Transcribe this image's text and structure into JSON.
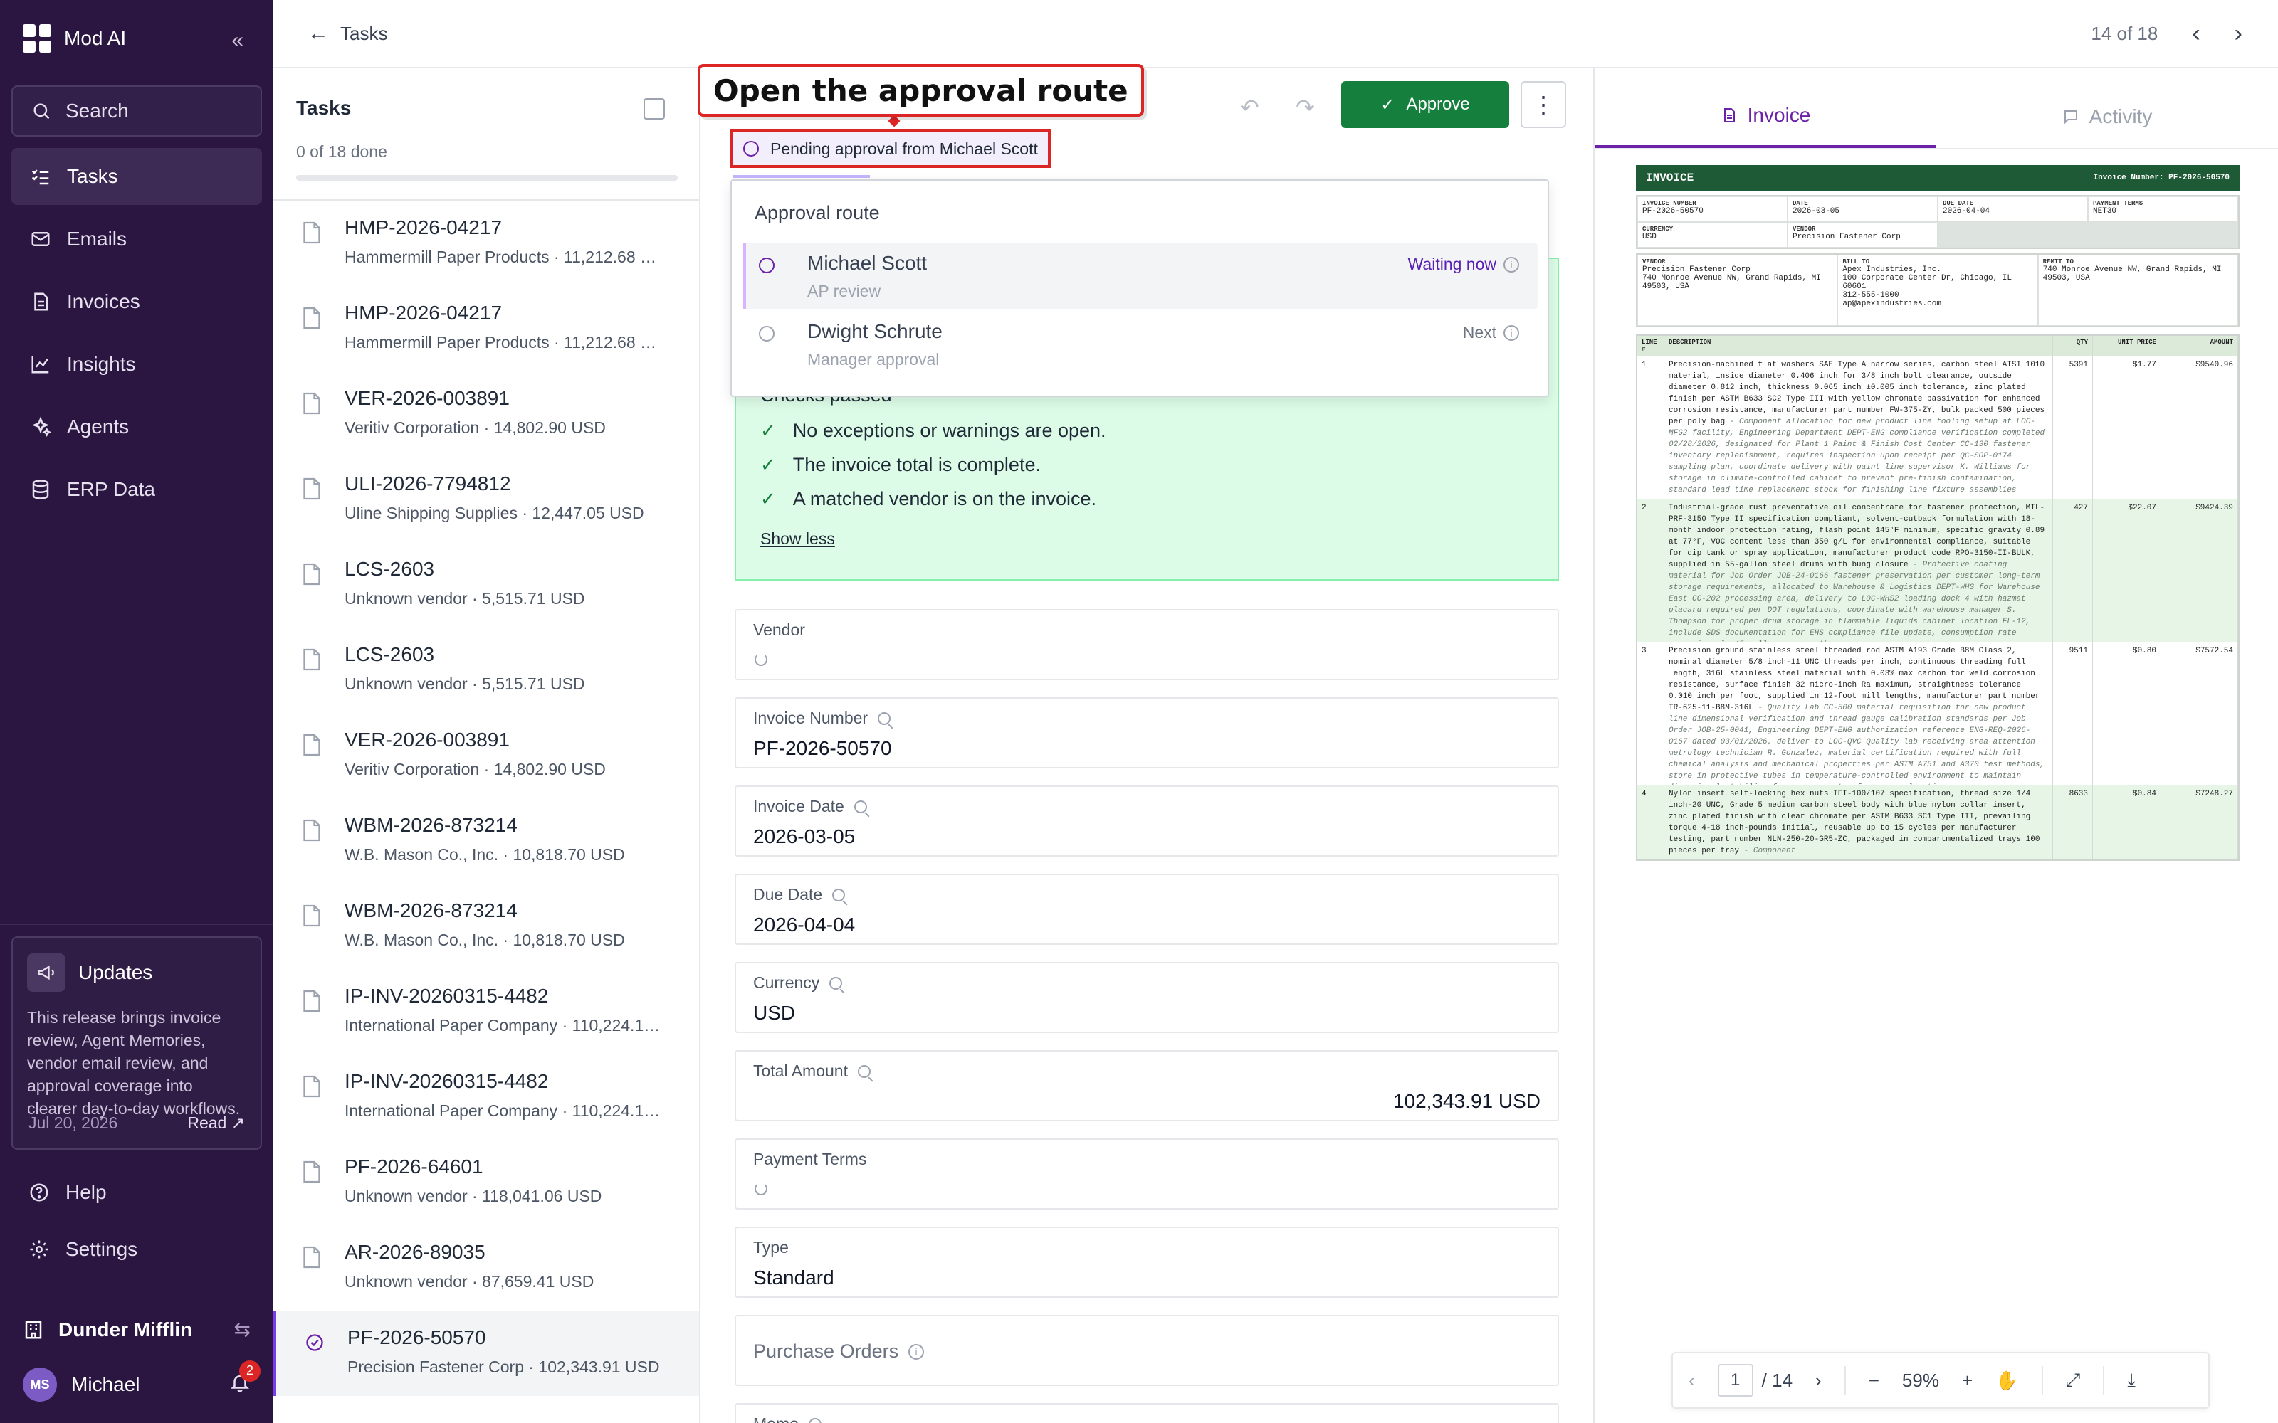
{
  "nav": {
    "brand": "Mod AI",
    "search_label": "Search",
    "items": [
      {
        "label": "Tasks",
        "icon": "tasks-icon"
      },
      {
        "label": "Emails",
        "icon": "mail-icon"
      },
      {
        "label": "Invoices",
        "icon": "file-icon"
      },
      {
        "label": "Insights",
        "icon": "chart-icon"
      },
      {
        "label": "Agents",
        "icon": "agents-icon"
      },
      {
        "label": "ERP Data",
        "icon": "database-icon"
      }
    ],
    "updates": {
      "title": "Updates",
      "body": "This release brings invoice review, Agent Memories, vendor email review, and approval coverage into clearer day-to-day workflows.",
      "date": "Jul 20, 2026",
      "read_label": "Read"
    },
    "help_label": "Help",
    "settings_label": "Settings",
    "org_name": "Dunder Mifflin",
    "user": {
      "initials": "MS",
      "name": "Michael",
      "notifications": "2"
    }
  },
  "topbar": {
    "back_label": "Tasks",
    "position": "14 of 18"
  },
  "task_list": {
    "title": "Tasks",
    "progress_text": "0 of 18 done",
    "progress_fraction": 0,
    "items": [
      {
        "id": "HMP-2026-04217",
        "subtitle": "Hammermill Paper Products · 11,212.68 …"
      },
      {
        "id": "HMP-2026-04217",
        "subtitle": "Hammermill Paper Products · 11,212.68 …"
      },
      {
        "id": "VER-2026-003891",
        "subtitle": "Veritiv Corporation · 14,802.90 USD"
      },
      {
        "id": "ULI-2026-7794812",
        "subtitle": "Uline Shipping Supplies · 12,447.05 USD"
      },
      {
        "id": "LCS-2603",
        "subtitle": "Unknown vendor · 5,515.71 USD"
      },
      {
        "id": "LCS-2603",
        "subtitle": "Unknown vendor · 5,515.71 USD"
      },
      {
        "id": "VER-2026-003891",
        "subtitle": "Veritiv Corporation · 14,802.90 USD"
      },
      {
        "id": "WBM-2026-873214",
        "subtitle": "W.B. Mason Co., Inc. · 10,818.70 USD"
      },
      {
        "id": "WBM-2026-873214",
        "subtitle": "W.B. Mason Co., Inc. · 10,818.70 USD"
      },
      {
        "id": "IP-INV-20260315-4482",
        "subtitle": "International Paper Company · 110,224.1…"
      },
      {
        "id": "IP-INV-20260315-4482",
        "subtitle": "International Paper Company · 110,224.1…"
      },
      {
        "id": "PF-2026-64601",
        "subtitle": "Unknown vendor · 118,041.06 USD"
      },
      {
        "id": "AR-2026-89035",
        "subtitle": "Unknown vendor · 87,659.41 USD"
      },
      {
        "id": "PF-2026-50570",
        "subtitle": "Precision Fastener Corp · 102,343.91 USD"
      }
    ]
  },
  "callout": "Open the approval route",
  "pending_chip": "Pending approval from Michael Scott",
  "toolbar": {
    "approve_label": "Approve",
    "more_label": "⋮"
  },
  "approval_route": {
    "title": "Approval route",
    "steps": [
      {
        "name": "Michael Scott",
        "role": "AP review",
        "status": "Waiting now"
      },
      {
        "name": "Dwight Schrute",
        "role": "Manager approval",
        "status": "Next"
      }
    ]
  },
  "checks": {
    "heading": "Checks passed",
    "items": [
      "No exceptions or warnings are open.",
      "The invoice total is complete.",
      "A matched vendor is on the invoice."
    ],
    "toggle_label": "Show less"
  },
  "fields": {
    "vendor": {
      "label": "Vendor"
    },
    "invoice_number": {
      "label": "Invoice Number",
      "value": "PF-2026-50570"
    },
    "invoice_date": {
      "label": "Invoice Date",
      "value": "2026-03-05"
    },
    "due_date": {
      "label": "Due Date",
      "value": "2026-04-04"
    },
    "currency": {
      "label": "Currency",
      "value": "USD"
    },
    "total_amount": {
      "label": "Total Amount",
      "value": "102,343.91 USD"
    },
    "payment_terms": {
      "label": "Payment Terms"
    },
    "type": {
      "label": "Type",
      "value": "Standard"
    },
    "purchase_orders": {
      "label": "Purchase Orders"
    },
    "memo": {
      "label": "Memo"
    }
  },
  "preview": {
    "tabs": [
      {
        "label": "Invoice"
      },
      {
        "label": "Activity"
      }
    ],
    "pdf": {
      "page": "1",
      "total": "/ 14",
      "zoom": "59%"
    },
    "doc": {
      "title": "INVOICE",
      "number_label": "Invoice Number: PF-2026-50570",
      "meta": [
        {
          "k": "INVOICE NUMBER",
          "v": "PF-2026-50570"
        },
        {
          "k": "DATE",
          "v": "2026-03-05"
        },
        {
          "k": "DUE DATE",
          "v": "2026-04-04"
        },
        {
          "k": "PAYMENT TERMS",
          "v": "NET30"
        },
        {
          "k": "CURRENCY",
          "v": "USD"
        },
        {
          "k": "VENDOR",
          "v": "Precision Fastener Corp"
        }
      ],
      "vendor_block": {
        "k": "VENDOR",
        "lines": "Precision Fastener Corp\n740 Monroe Avenue NW, Grand Rapids, MI 49503, USA"
      },
      "bill_to_block": {
        "k": "BILL TO",
        "lines": "Apex Industries, Inc.\n100 Corporate Center Dr, Chicago, IL 60601\n312-555-1000\nap@apexindustries.com"
      },
      "remit_block": {
        "k": "REMIT TO",
        "lines": "740 Monroe Avenue NW, Grand Rapids, MI 49503, USA"
      },
      "line_headers": [
        "LINE #",
        "DESCRIPTION",
        "QTY",
        "UNIT PRICE",
        "AMOUNT"
      ],
      "lines": [
        {
          "n": "1",
          "desc": "Precision-machined flat washers SAE Type A narrow series, carbon steel AISI 1010 material, inside diameter 0.406 inch for 3/8 inch bolt clearance, outside diameter 0.812 inch, thickness 0.065 inch ±0.005 inch tolerance, zinc plated finish per ASTM B633 SC2 Type III with yellow chromate passivation for enhanced corrosion resistance, manufacturer part number FW-375-ZY, bulk packed 500 pieces per poly bag",
          "memo": "- Component allocation for new product line tooling setup at LOC-MFG2 facility, Engineering Department DEPT-ENG compliance verification completed 02/28/2026, designated for Plant 1 Paint & Finish Cost Center CC-130 fastener inventory replenishment, requires inspection upon receipt per QC-SOP-0174 sampling plan, coordinate delivery with paint line supervisor K. Williams for storage in climate-controlled cabinet to prevent pre-finish contamination, standard lead time replacement stock for finishing line fixture assemblies",
          "qty": "5391",
          "price": "$1.77",
          "amount": "$9540.96"
        },
        {
          "n": "2",
          "desc": "Industrial-grade rust preventative oil concentrate for fastener protection, MIL-PRF-3150 Type II specification compliant, solvent-cutback formulation with 18-month indoor protection rating, flash point 145°F minimum, specific gravity 0.89 at 77°F, VOC content less than 350 g/L for environmental compliance, suitable for dip tank or spray application, manufacturer product code RPO-3150-II-BULK, supplied in 55-gallon steel drums with bung closure",
          "memo": "- Protective coating material for Job Order JOB-24-0166 fastener preservation per customer long-term storage requirements, allocated to Warehouse & Logistics DEPT-WHS for Warehouse East CC-202 processing area, delivery to LOC-WHS2 loading dock 4 with hazmat placard required per DOT regulations, coordinate with warehouse manager S. Thompson for proper drum storage in flammable liquids cabinet location FL-12, include SDS documentation for EHS compliance file update, consumption rate approximately 45 gallons per month",
          "qty": "427",
          "price": "$22.07",
          "amount": "$9424.39"
        },
        {
          "n": "3",
          "desc": "Precision ground stainless steel threaded rod ASTM A193 Grade B8M Class 2, nominal diameter 5/8 inch-11 UNC threads per inch, continuous threading full length, 316L stainless steel material with 0.03% max carbon for weld corrosion resistance, surface finish 32 micro-inch Ra maximum, straightness tolerance 0.010 inch per foot, supplied in 12-foot mill lengths, manufacturer part number TR-625-11-B8M-316L",
          "memo": "- Quality Lab CC-500 material requisition for new product line dimensional verification and thread gauge calibration standards per Job Order JOB-25-0041, Engineering DEPT-ENG authorization reference ENG-REQ-2026-0167 dated 03/01/2026, deliver to LOC-QVC Quality lab receiving area attention metrology technician R. Gonzalez, material certification required with full chemical analysis and mechanical properties per ASTM A751 and A370 test methods, store in protective tubes in temperature-controlled environment to maintain dimensional stability for measurement reference applications",
          "qty": "9511",
          "price": "$0.80",
          "amount": "$7572.54"
        },
        {
          "n": "4",
          "desc": "Nylon insert self-locking hex nuts IFI-100/107 specification, thread size 1/4 inch-20 UNC, Grade 5 medium carbon steel body with blue nylon collar insert, zinc plated finish with clear chromate per ASTM B633 SC1 Type III, prevailing torque 4-18 inch-pounds initial, reusable up to 15 cycles per manufacturer testing, part number NLN-250-20-GR5-ZC, packaged in compartmentalized trays 100 pieces per tray",
          "memo": "- Component",
          "qty": "8633",
          "price": "$0.84",
          "amount": "$7248.27"
        }
      ]
    }
  }
}
